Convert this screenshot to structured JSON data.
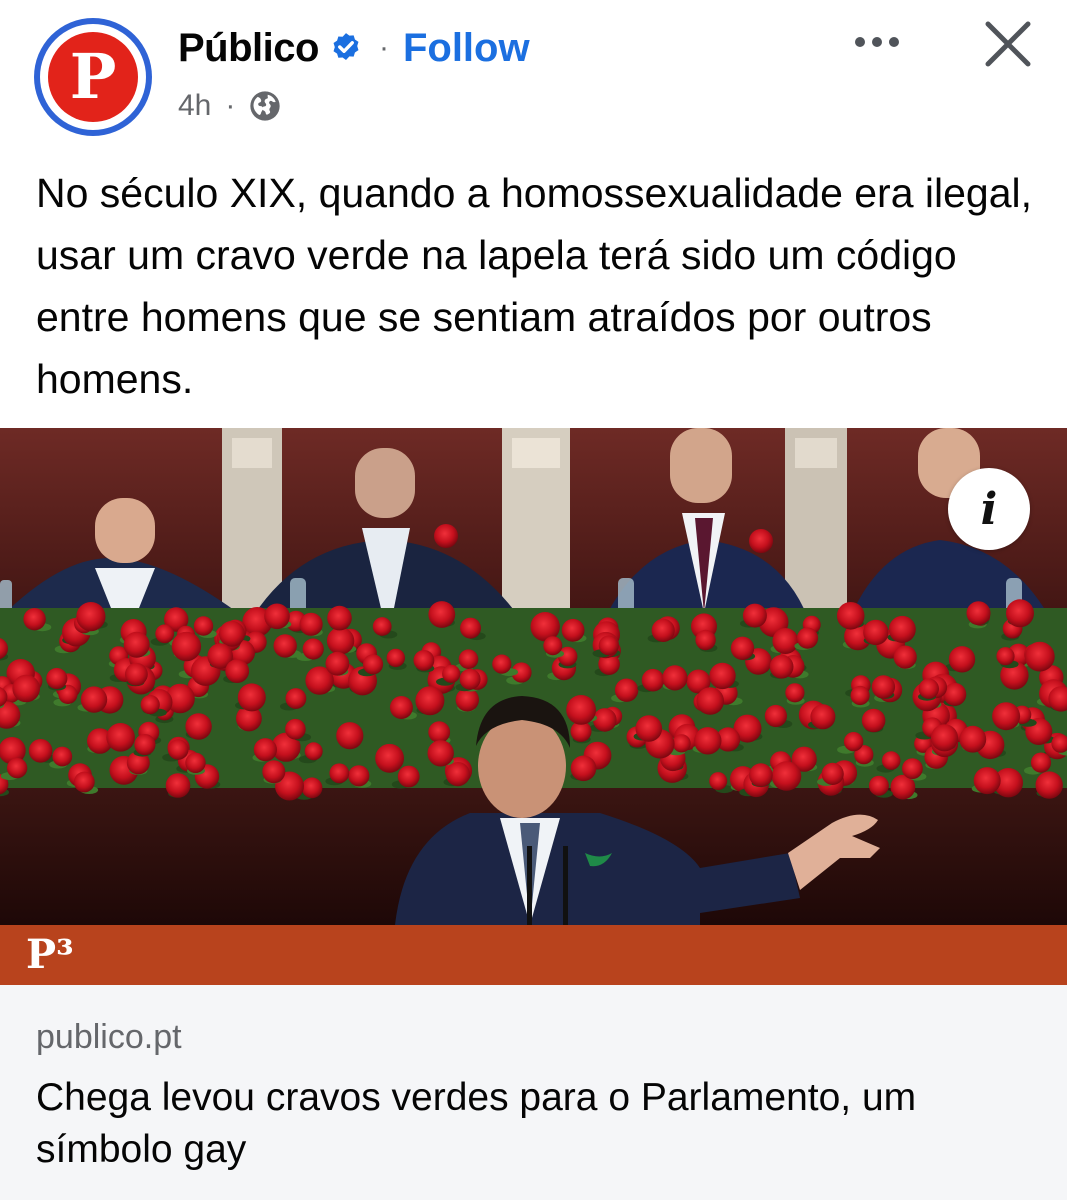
{
  "header": {
    "page_name": "Público",
    "follow_label": "Follow",
    "separator": "·",
    "timestamp": "4h",
    "audience_icon": "globe-icon",
    "verified_icon": "verified-badge-icon",
    "more_icon": "more-options-icon",
    "close_icon": "close-icon",
    "avatar_letter": "P"
  },
  "post": {
    "text": "No século XIX, quando a homossexualidade era ilegal, usar um cravo verde na lapela terá sido um código entre homens que se sentiam atraídos por outros homens."
  },
  "image": {
    "info_icon": "info-icon",
    "info_glyph": "i",
    "brand_label": "P³"
  },
  "link_preview": {
    "domain": "publico.pt",
    "title": "Chega levou cravos verdes para o Parlamento, um símbolo gay"
  },
  "colors": {
    "follow": "#1b6fe0",
    "verified": "#1b6fe0",
    "avatar_ring": "#2f63d6",
    "avatar_core": "#e2231a",
    "brand_bar": "#b8431d",
    "meta_text": "#65676b",
    "card_bg": "#f5f6f8"
  }
}
